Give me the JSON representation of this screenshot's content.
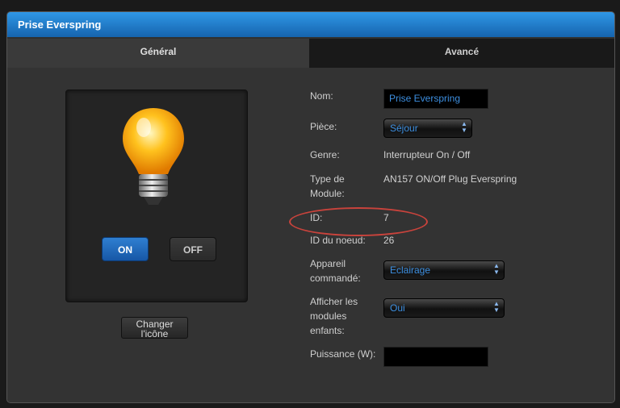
{
  "window": {
    "title": "Prise Everspring"
  },
  "tabs": {
    "general": "Général",
    "advanced": "Avancé"
  },
  "icon_panel": {
    "on_label": "ON",
    "off_label": "OFF",
    "change_label_1": "Changer",
    "change_label_2": "l'icône"
  },
  "form": {
    "name": {
      "label": "Nom:",
      "value": "Prise Everspring"
    },
    "room": {
      "label": "Pièce:",
      "value": "Séjour"
    },
    "genre": {
      "label": "Genre:",
      "value": "Interrupteur On / Off"
    },
    "module_type": {
      "label_1": "Type de",
      "label_2": "Module:",
      "value": "AN157 ON/Off Plug Everspring"
    },
    "id": {
      "label": "ID:",
      "value": "7"
    },
    "node_id": {
      "label": "ID du noeud:",
      "value": "26"
    },
    "controlled_device": {
      "label_1": "Appareil",
      "label_2": "commandé:",
      "value": "Eclairage"
    },
    "show_children": {
      "label_1": "Afficher les",
      "label_2": "modules",
      "label_3": "enfants:",
      "value": "Oui"
    },
    "power": {
      "label": "Puissance (W):",
      "value": ""
    }
  },
  "colors": {
    "accent": "#2f7fd1",
    "highlight_ellipse": "#c9433c"
  }
}
